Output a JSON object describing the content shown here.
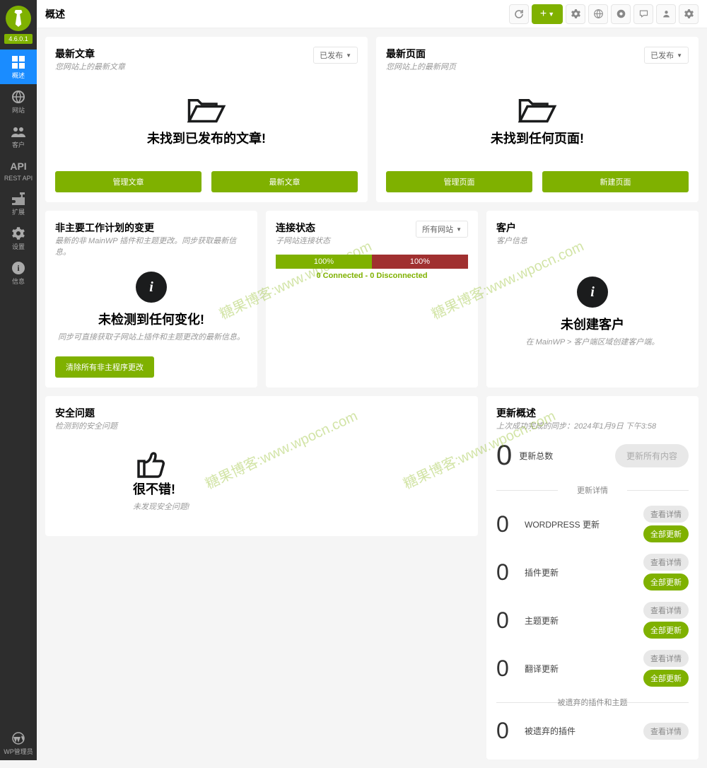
{
  "version": "4.6.0.1",
  "page_title": "概述",
  "sidebar": {
    "items": [
      {
        "label": "概述"
      },
      {
        "label": "网站"
      },
      {
        "label": "客户"
      },
      {
        "label": "REST API",
        "api": "API"
      },
      {
        "label": "扩展"
      },
      {
        "label": "设置"
      },
      {
        "label": "信息"
      }
    ],
    "bottom": {
      "label": "WP管理员"
    }
  },
  "cards": {
    "posts": {
      "title": "最新文章",
      "sub": "您网站上的最新文章",
      "filter": "已发布",
      "empty": "未找到已发布的文章!",
      "btn1": "管理文章",
      "btn2": "最新文章"
    },
    "pages": {
      "title": "最新页面",
      "sub": "您网站上的最新网页",
      "filter": "已发布",
      "empty": "未找到任何页面!",
      "btn1": "管理页面",
      "btn2": "新建页面"
    },
    "nonmain": {
      "title": "非主要工作计划的变更",
      "sub": "最新的非 MainWP 插件和主题更改。同步获取最新信息。",
      "empty": "未检测到任何变化!",
      "empty_sub": "同步可直接获取子网站上插件和主题更改的最新信息。",
      "btn": "清除所有非主程序更改"
    },
    "conn": {
      "title": "连接状态",
      "sub": "子网站连接状态",
      "filter": "所有网站",
      "pct1": "100%",
      "pct2": "100%",
      "status": "0 Connected - 0 Disconnected"
    },
    "clients": {
      "title": "客户",
      "sub": "客户信息",
      "empty": "未创建客户",
      "empty_sub": "在 MainWP > 客户端区域创建客户端。"
    },
    "security": {
      "title": "安全问题",
      "sub": "检测到的安全问题",
      "empty": "很不错!",
      "empty_sub": "未发现安全问题!"
    },
    "updates": {
      "title": "更新概述",
      "sync": "上次成功完成的同步：2024年1月9日 下午3:58",
      "total_label": "更新总数",
      "total": "0",
      "update_all": "更新所有内容",
      "divider1": "更新详情",
      "divider2": "被遗弃的插件和主题",
      "view_details": "查看详情",
      "update_all_small": "全部更新",
      "rows": [
        {
          "count": "0",
          "label": "WORDPRESS 更新"
        },
        {
          "count": "0",
          "label": "插件更新"
        },
        {
          "count": "0",
          "label": "主题更新"
        },
        {
          "count": "0",
          "label": "翻译更新"
        }
      ],
      "abandoned": [
        {
          "count": "0",
          "label": "被遗弃的插件"
        }
      ]
    }
  }
}
